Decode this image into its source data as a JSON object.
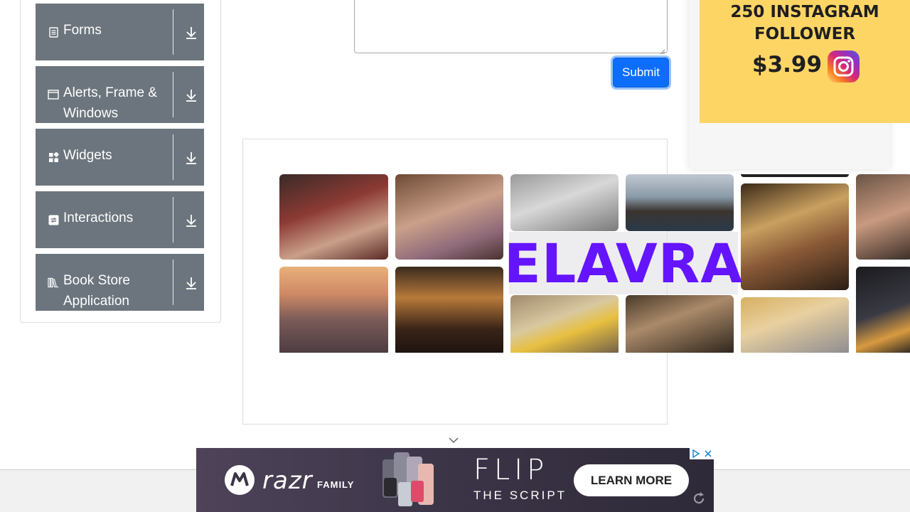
{
  "sidebar": {
    "groups": [
      {
        "label": "Forms",
        "icon": "form-icon"
      },
      {
        "label": "Alerts, Frame & Windows",
        "icon": "window-icon"
      },
      {
        "label": "Widgets",
        "icon": "widgets-icon"
      },
      {
        "label": "Interactions",
        "icon": "interactions-icon"
      },
      {
        "label": "Book Store Application",
        "icon": "books-icon"
      }
    ]
  },
  "form": {
    "submit_label": "Submit"
  },
  "center_ad": {
    "brand": "ELAVRA"
  },
  "right_ad": {
    "title": "250 INSTAGRAM FOLLOWER",
    "price": "$3.99",
    "background": "#fdd565"
  },
  "bottom_ad": {
    "brand": "razr",
    "brand_suffix": "FAMILY",
    "headline": "FLIP",
    "subline": "THE SCRIPT",
    "cta": "LEARN MORE"
  },
  "colors": {
    "sidebar_group_bg": "#6c757d",
    "submit_bg": "#0d6efd",
    "elavra_text": "#6414ff"
  }
}
